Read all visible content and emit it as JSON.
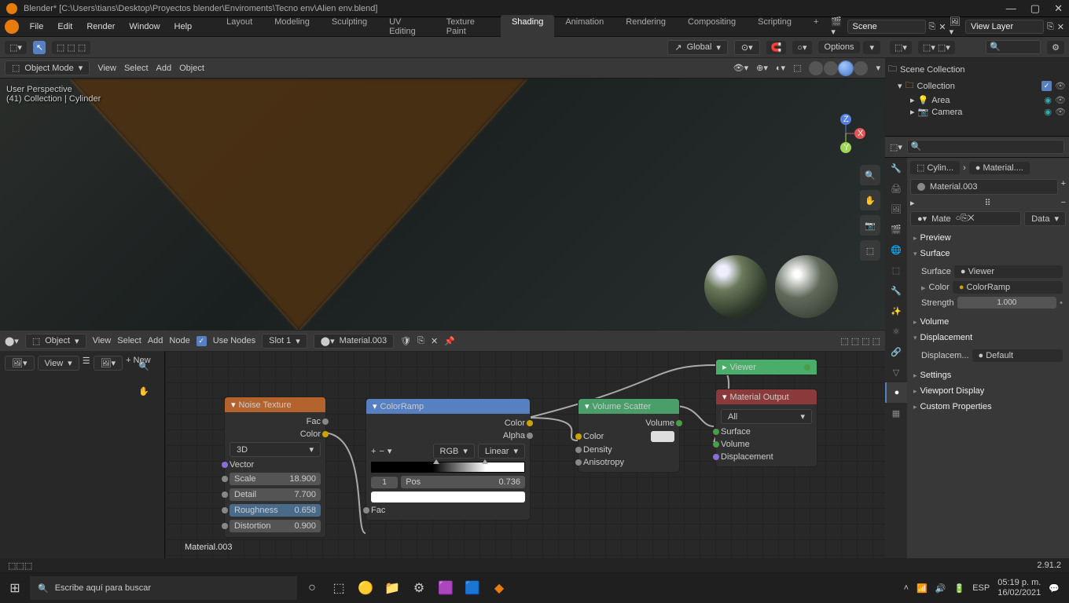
{
  "title": "Blender* [C:\\Users\\tians\\Desktop\\Proyectos blender\\Enviroments\\Tecno env\\Alien env.blend]",
  "menus": [
    "File",
    "Edit",
    "Render",
    "Window",
    "Help"
  ],
  "workspaces": [
    "Layout",
    "Modeling",
    "Sculpting",
    "UV Editing",
    "Texture Paint",
    "Shading",
    "Animation",
    "Rendering",
    "Compositing",
    "Scripting"
  ],
  "active_ws": "Shading",
  "scene": "Scene",
  "viewlayer": "View Layer",
  "vp": {
    "mode": "Object Mode",
    "menus": [
      "View",
      "Select",
      "Add",
      "Object"
    ],
    "orient": "Global",
    "options": "Options",
    "perspective": "User Perspective",
    "context": "(41) Collection | Cylinder"
  },
  "outliner": {
    "title": "Scene Collection",
    "coll": "Collection",
    "items": [
      "Area",
      "Camera"
    ]
  },
  "node": {
    "mode": "Object",
    "menus": [
      "View",
      "Select",
      "Add",
      "Node"
    ],
    "use_nodes": "Use Nodes",
    "slot": "Slot 1",
    "material": "Material.003",
    "view_label": "View",
    "new_label": "New",
    "noise": {
      "title": "Noise Texture",
      "dim": "3D",
      "vector": "Vector",
      "scale_l": "Scale",
      "scale_v": "18.900",
      "detail_l": "Detail",
      "detail_v": "7.700",
      "rough_l": "Roughness",
      "rough_v": "0.658",
      "dist_l": "Distortion",
      "dist_v": "0.900",
      "fac": "Fac",
      "color": "Color"
    },
    "ramp": {
      "title": "ColorRamp",
      "rgb": "RGB",
      "linear": "Linear",
      "pos_idx": "1",
      "pos_l": "Pos",
      "pos_v": "0.736",
      "color": "Color",
      "alpha": "Alpha",
      "fac": "Fac"
    },
    "scatter": {
      "title": "Volume Scatter",
      "volume": "Volume",
      "color": "Color",
      "density": "Density",
      "aniso": "Anisotropy"
    },
    "viewer": {
      "title": "Viewer"
    },
    "output": {
      "title": "Material Output",
      "all": "All",
      "surface": "Surface",
      "volume": "Volume",
      "disp": "Displacement"
    },
    "mat_label": "Material.003"
  },
  "props": {
    "obj": "Cylin...",
    "mat": "Material....",
    "slot_mat": "Material.003",
    "mate_dd": "Mate",
    "data_dd": "Data",
    "preview": "Preview",
    "surface": "Surface",
    "surface_l": "Surface",
    "surface_v": "Viewer",
    "color_l": "Color",
    "color_v": "ColorRamp",
    "strength_l": "Strength",
    "strength_v": "1.000",
    "volume": "Volume",
    "displacement": "Displacement",
    "disp_l": "Displacem...",
    "disp_v": "Default",
    "settings": "Settings",
    "vpd": "Viewport Display",
    "custom": "Custom Properties"
  },
  "status": {
    "version": "2.91.2"
  },
  "taskbar": {
    "search": "Escribe aquí para buscar",
    "lang": "ESP",
    "time": "05:19 p. m.",
    "date": "16/02/2021"
  }
}
